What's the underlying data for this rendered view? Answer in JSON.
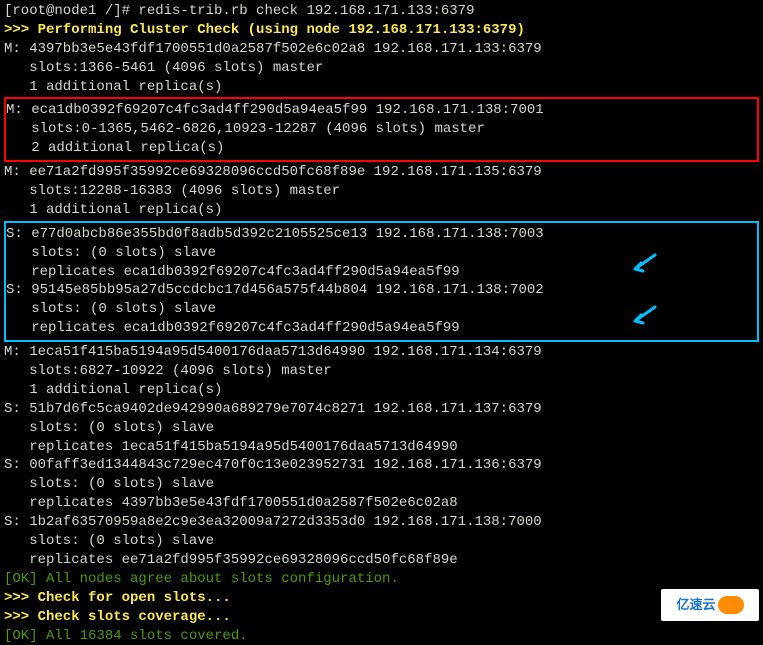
{
  "prompt": "[root@node1 /]# redis-trib.rb check 192.168.171.133:6379",
  "header": ">>> Performing Cluster Check (using node 192.168.171.133:6379)",
  "master1": {
    "l1": "M: 4397bb3e5e43fdf1700551d0a2587f502e6c02a8 192.168.171.133:6379",
    "l2": "   slots:1366-5461 (4096 slots) master",
    "l3": "   1 additional replica(s)"
  },
  "master2": {
    "l1": "M: eca1db0392f69207c4fc3ad4ff290d5a94ea5f99 192.168.171.138:7001",
    "l2": "   slots:0-1365,5462-6826,10923-12287 (4096 slots) master",
    "l3": "   2 additional replica(s)"
  },
  "master3": {
    "l1": "M: ee71a2fd995f35992ce69328096ccd50fc68f89e 192.168.171.135:6379",
    "l2": "   slots:12288-16383 (4096 slots) master",
    "l3": "   1 additional replica(s)"
  },
  "slave1": {
    "l1": "S: e77d0abcb86e355bd0f8adb5d392c2105525ce13 192.168.171.138:7003",
    "l2": "   slots: (0 slots) slave",
    "l3": "   replicates eca1db0392f69207c4fc3ad4ff290d5a94ea5f99"
  },
  "slave2": {
    "l1": "S: 95145e85bb95a27d5ccdcbc17d456a575f44b804 192.168.171.138:7002",
    "l2": "   slots: (0 slots) slave",
    "l3": "   replicates eca1db0392f69207c4fc3ad4ff290d5a94ea5f99"
  },
  "master4": {
    "l1": "M: 1eca51f415ba5194a95d5400176daa5713d64990 192.168.171.134:6379",
    "l2": "   slots:6827-10922 (4096 slots) master",
    "l3": "   1 additional replica(s)"
  },
  "slave3": {
    "l1": "S: 51b7d6fc5ca9402de942990a689279e7074c8271 192.168.171.137:6379",
    "l2": "   slots: (0 slots) slave",
    "l3": "   replicates 1eca51f415ba5194a95d5400176daa5713d64990"
  },
  "slave4": {
    "l1": "S: 00faff3ed1344843c729ec470f0c13e023952731 192.168.171.136:6379",
    "l2": "   slots: (0 slots) slave",
    "l3": "   replicates 4397bb3e5e43fdf1700551d0a2587f502e6c02a8"
  },
  "slave5": {
    "l1": "S: 1b2af63570959a8e2c9e3ea32009a7272d3353d0 192.168.171.138:7000",
    "l2": "   slots: (0 slots) slave",
    "l3": "   replicates ee71a2fd995f35992ce69328096ccd50fc68f89e"
  },
  "ok1": "[OK] All nodes agree about slots configuration.",
  "check1": ">>> Check for open slots...",
  "check2": ">>> Check slots coverage...",
  "ok2": "[OK] All 16384 slots covered.",
  "watermark": "亿速云",
  "arrow_glyph": "↘"
}
